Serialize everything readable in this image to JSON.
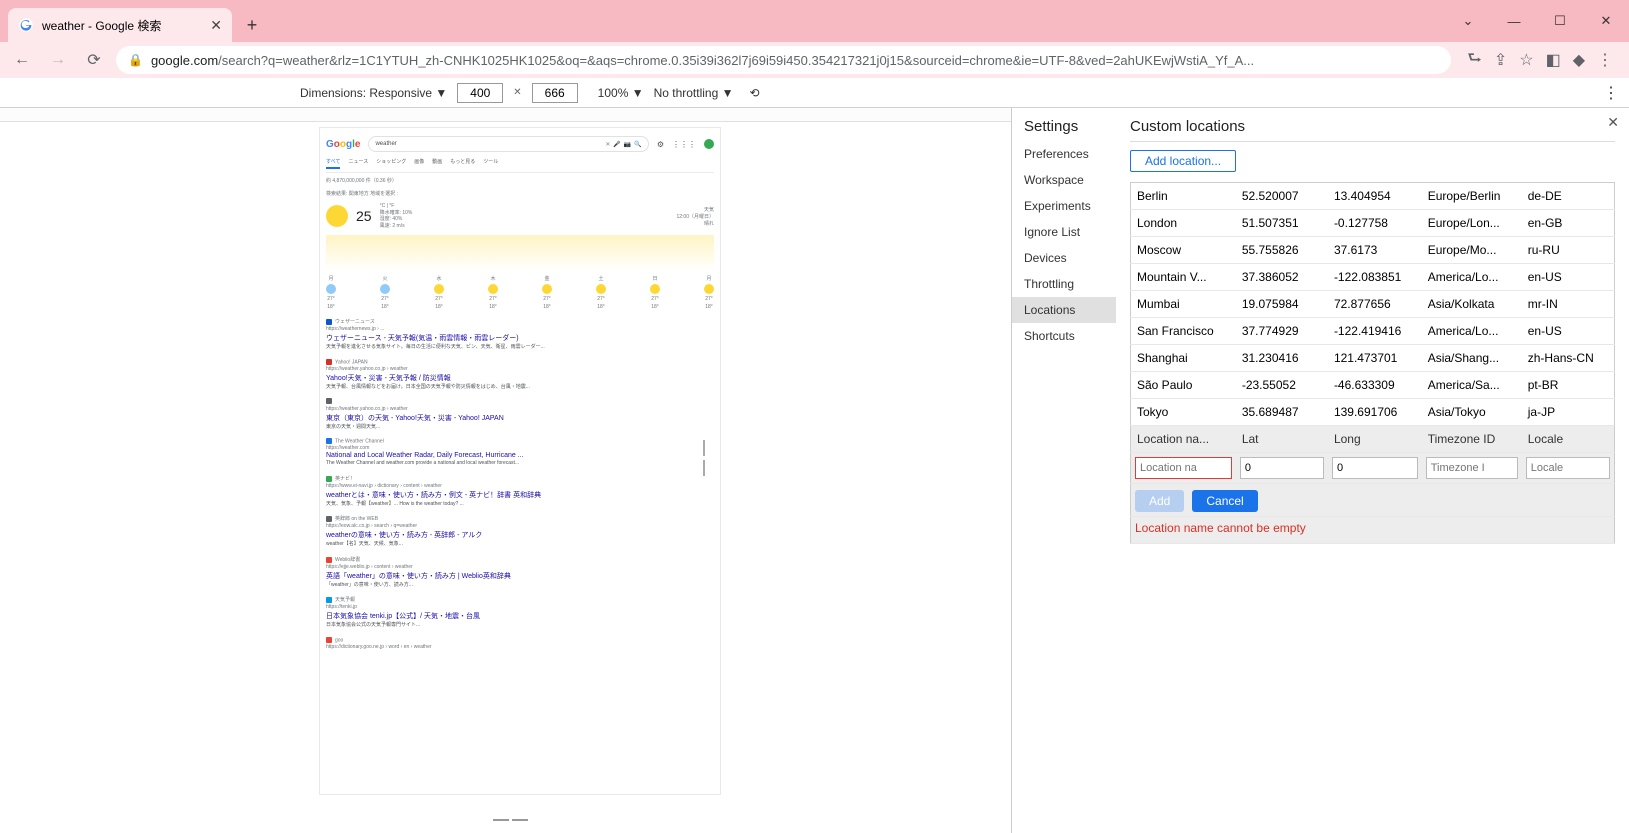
{
  "tab": {
    "title": "weather - Google 検索"
  },
  "url": {
    "host": "google.com",
    "path": "/search?q=weather&rlz=1C1YTUH_zh-CNHK1025HK1025&oq=&aqs=chrome.0.35i39i362l7j69i59i450.354217321j0j15&sourceid=chrome&ie=UTF-8&ved=2ahUKEwjWstiA_Yf_A..."
  },
  "devbar": {
    "dimensions_label": "Dimensions: Responsive ▼",
    "width": "400",
    "height": "666",
    "x": "✕",
    "zoom": "100% ▼",
    "throttling": "No throttling ▼"
  },
  "google": {
    "query": "weather",
    "tabs": [
      "すべて",
      "ニュース",
      "ショッピング",
      "画像",
      "動画",
      "もっと見る",
      "ツール"
    ],
    "stats": "約 4,870,000,000 件（0.36 秒）",
    "loc_label": "検索結果: 関東地方 地域を選択 :",
    "temp": "25",
    "temp_unit": "°C | °F",
    "precip": "降水確率: 10%",
    "hum": "湿度: 40%",
    "wind": "風速: 2 m/s",
    "weather_word": "天気",
    "time_label": "12:00（月曜日）",
    "cond": "晴れ",
    "forecast_days": [
      "月",
      "火",
      "水",
      "木",
      "金",
      "土",
      "日",
      "月"
    ],
    "results": [
      {
        "fav": "#0b57d0",
        "name": "ウェザーニュース",
        "url": "https://weathernews.jp › ...",
        "title": "ウェザーニュース - 天気予報(気温・雨雲情報・雨雲レーダー)",
        "snip": "天気予報を進化させる気象サイト。毎日の生活に便利な天気、ピン、天気、衛星、雨雲レーダー..."
      },
      {
        "fav": "#d93025",
        "name": "Yahoo! JAPAN",
        "url": "https://weather.yahoo.co.jp › weather",
        "title": "Yahoo!天気・災害 - 天気予報 / 防災情報",
        "snip": "天気予報、台風情報などをお届け。日本全国の天気予報や防災情報をはじめ、台風・地震..."
      },
      {
        "fav": "#5f6368",
        "name": "",
        "url": "https://weather.yahoo.co.jp › weather",
        "title": "東京（東京）の天気 - Yahoo!天気・災害 - Yahoo! JAPAN",
        "snip": "東京の天気・週間天気..."
      },
      {
        "fav": "#1a73e8",
        "name": "The Weather Channel",
        "url": "https://weather.com",
        "title": "National and Local Weather Radar, Daily Forecast, Hurricane ...",
        "snip": "The Weather Channel and weather.com provide a national and local weather forecast..."
      },
      {
        "fav": "#34a853",
        "name": "英ナビ！",
        "url": "https://www.ei-navi.jp › dictionary › content › weather",
        "title": "weatherとは・意味・使い方・読み方・例文 - 英ナビ！辞書 英和辞典",
        "snip": "天気、気象、予報【weather】... How is the weather today? ..."
      },
      {
        "fav": "#5f6368",
        "name": "英辞郎 on the WEB",
        "url": "https://eow.alc.co.jp › search › q=weather",
        "title": "weatherの意味・使い方・読み方 - 英辞郎 - アルク",
        "snip": "weather【名】天気、天候、気象..."
      },
      {
        "fav": "#ea4335",
        "name": "Weblio辞書",
        "url": "https://ejje.weblio.jp › content › weather",
        "title": "英語「weather」の意味・使い方・読み方 | Weblio英和辞典",
        "snip": "「weather」の意味・使い方、読み方..."
      },
      {
        "fav": "#039be5",
        "name": "天気予報",
        "url": "https://tenki.jp",
        "title": "日本気象協会 tenki.jp【公式】/ 天気・地震・台風",
        "snip": "日本気象協会公式の天気予報専門サイト..."
      },
      {
        "fav": "#ea4335",
        "name": "goo",
        "url": "https://dictionary.goo.ne.jp › word › en › weather",
        "title": "",
        "snip": ""
      }
    ]
  },
  "settings": {
    "title": "Settings",
    "nav": [
      "Preferences",
      "Workspace",
      "Experiments",
      "Ignore List",
      "Devices",
      "Throttling",
      "Locations",
      "Shortcuts"
    ],
    "active": "Locations",
    "main_title": "Custom locations",
    "add_btn": "Add location...",
    "headers": {
      "name": "Location na...",
      "lat": "Lat",
      "lon": "Long",
      "tz": "Timezone ID",
      "locale": "Locale"
    },
    "rows": [
      {
        "name": "Berlin",
        "lat": "52.520007",
        "lon": "13.404954",
        "tz": "Europe/Berlin",
        "locale": "de-DE"
      },
      {
        "name": "London",
        "lat": "51.507351",
        "lon": "-0.127758",
        "tz": "Europe/Lon...",
        "locale": "en-GB"
      },
      {
        "name": "Moscow",
        "lat": "55.755826",
        "lon": "37.6173",
        "tz": "Europe/Mo...",
        "locale": "ru-RU"
      },
      {
        "name": "Mountain V...",
        "lat": "37.386052",
        "lon": "-122.083851",
        "tz": "America/Lo...",
        "locale": "en-US"
      },
      {
        "name": "Mumbai",
        "lat": "19.075984",
        "lon": "72.877656",
        "tz": "Asia/Kolkata",
        "locale": "mr-IN"
      },
      {
        "name": "San Francisco",
        "lat": "37.774929",
        "lon": "-122.419416",
        "tz": "America/Lo...",
        "locale": "en-US"
      },
      {
        "name": "Shanghai",
        "lat": "31.230416",
        "lon": "121.473701",
        "tz": "Asia/Shang...",
        "locale": "zh-Hans-CN"
      },
      {
        "name": "São Paulo",
        "lat": "-23.55052",
        "lon": "-46.633309",
        "tz": "America/Sa...",
        "locale": "pt-BR"
      },
      {
        "name": "Tokyo",
        "lat": "35.689487",
        "lon": "139.691706",
        "tz": "Asia/Tokyo",
        "locale": "ja-JP"
      }
    ],
    "edit": {
      "name_ph": "Location na",
      "lat_val": "0",
      "lon_val": "0",
      "tz_ph": "Timezone I",
      "locale_ph": "Locale"
    },
    "btn_add": "Add",
    "btn_cancel": "Cancel",
    "error": "Location name cannot be empty"
  }
}
